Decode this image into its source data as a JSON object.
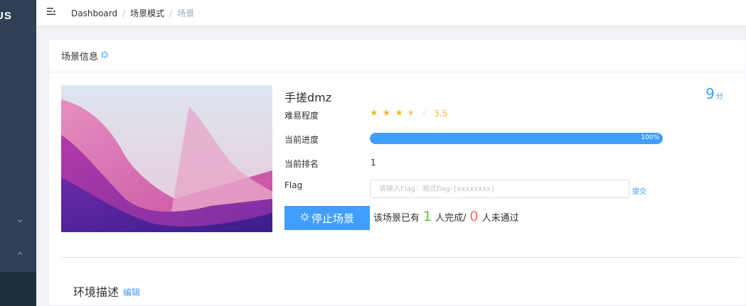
{
  "sidebar": {
    "logo_text": "US",
    "chevron_down": "⌵",
    "chevron_up": "˄"
  },
  "navbar": {
    "breadcrumb": [
      {
        "label": "Dashboard"
      },
      {
        "label": "场景模式"
      },
      {
        "label": "场景"
      }
    ],
    "separator": "/"
  },
  "card": {
    "header_title": "场景信息",
    "header_icon": "loading-icon",
    "scene_name": "手搓dmz",
    "score_value": "9",
    "score_unit": "分",
    "labels": {
      "difficulty": "难易程度",
      "progress": "当前进度",
      "rank": "当前排名",
      "flag": "Flag"
    },
    "rating": {
      "value": 3.5,
      "max": 5,
      "text": "3.5"
    },
    "progress": {
      "percent": 100,
      "text": "100%"
    },
    "rank_value": "1",
    "flag_input": {
      "value": "",
      "placeholder": "请输入Flag：格式flag-{xxxxxxxx}"
    },
    "submit_label": "提交",
    "stop_button_label": "停止场景",
    "stats": {
      "prefix": "该场景已有",
      "completed": "1",
      "completed_suffix": "人完成/",
      "failed": "0",
      "failed_suffix": "人未通过"
    },
    "desc_title": "环境描述",
    "desc_edit": "编辑"
  },
  "colors": {
    "primary": "#409eff",
    "success": "#67c23a",
    "danger": "#f56c6c",
    "star": "#f7ba2a",
    "sidebar": "#304156"
  }
}
